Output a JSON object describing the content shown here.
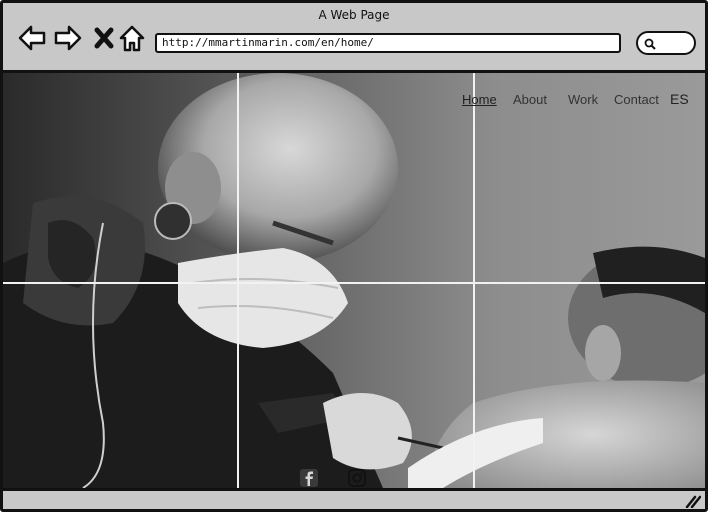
{
  "window": {
    "title": "A Web Page"
  },
  "toolbar": {
    "back_icon": "back-arrow-icon",
    "forward_icon": "forward-arrow-icon",
    "stop_icon": "close-x-icon",
    "home_icon": "home-icon",
    "url": "http://mmartinmarin.com/en/home/",
    "search_icon": "search-icon"
  },
  "site_nav": {
    "items": [
      {
        "label": "Home",
        "active": true
      },
      {
        "label": "About",
        "active": false
      },
      {
        "label": "Work",
        "active": false
      },
      {
        "label": "Contact",
        "active": false
      }
    ],
    "language": "ES"
  },
  "hero": {
    "image": "black-and-white photo of a tattoo artist wearing a face mask tattooing a client's back"
  },
  "social": [
    {
      "icon": "facebook-icon"
    },
    {
      "icon": "instagram-icon"
    }
  ],
  "colors": {
    "chrome": "#c8c8c8",
    "outline": "#111111",
    "grid_lines": "#f2f2f2"
  }
}
